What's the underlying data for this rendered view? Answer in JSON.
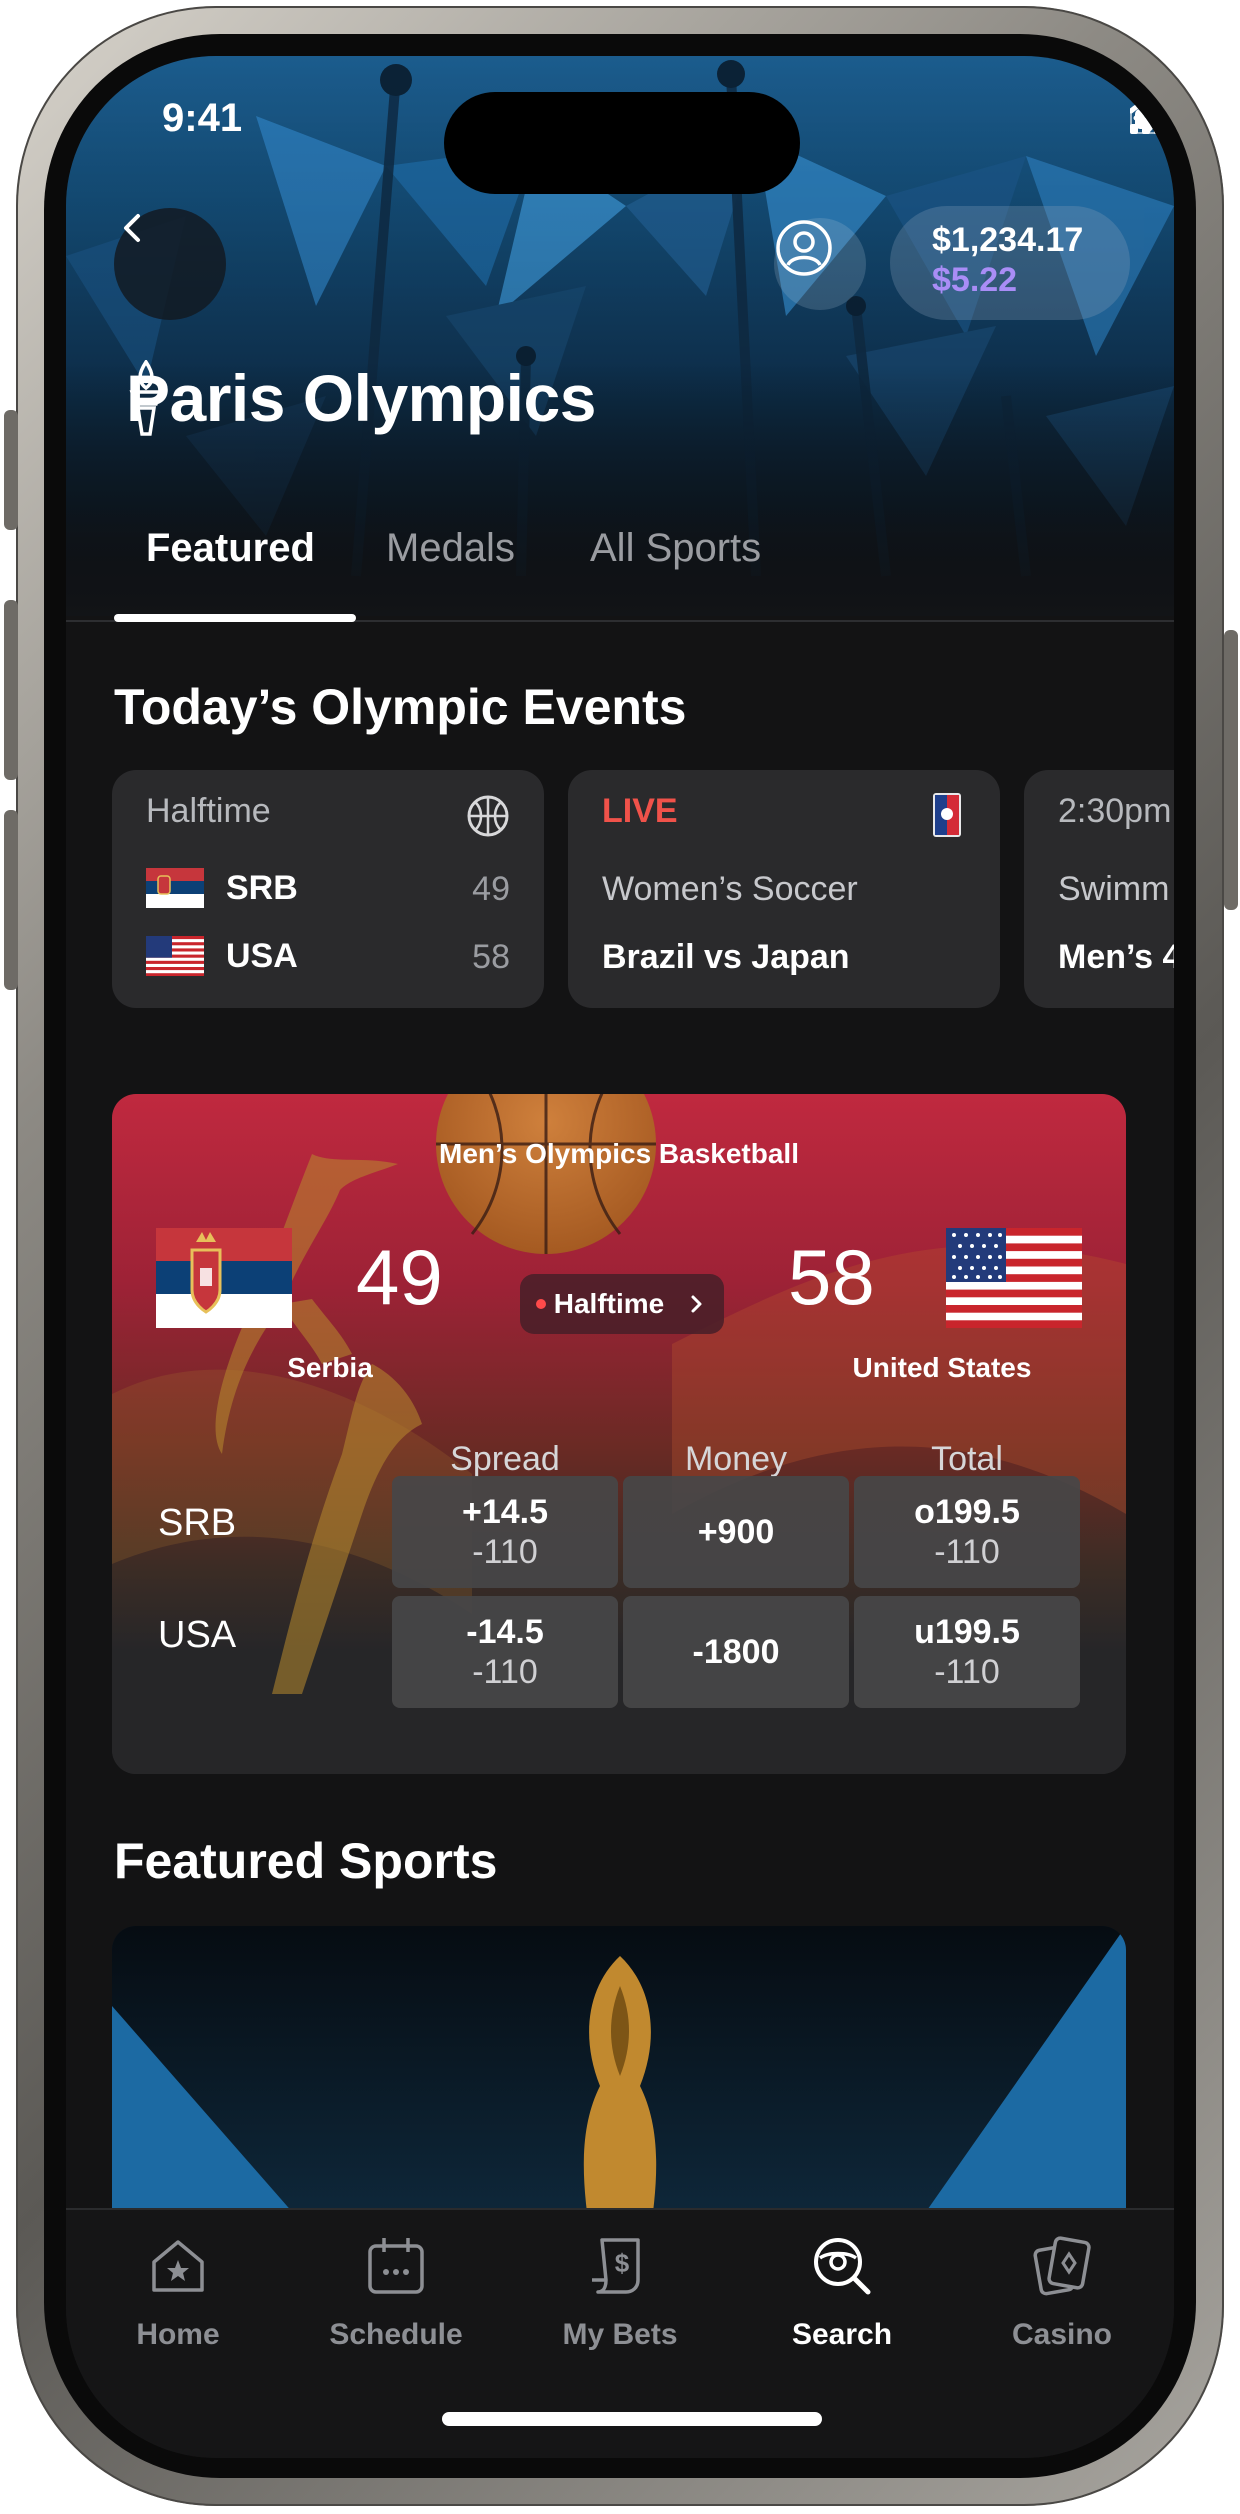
{
  "status_bar": {
    "time": "9:41"
  },
  "header": {
    "balance": "$1,234.17",
    "bonus_balance": "$5.22",
    "title": "Paris Olympics"
  },
  "tabs": [
    {
      "label": "Featured",
      "active": true
    },
    {
      "label": "Medals",
      "active": false
    },
    {
      "label": "All Sports",
      "active": false
    }
  ],
  "todays_events": {
    "title": "Today’s Olympic Events",
    "cards": [
      {
        "status": "Halftime",
        "icon": "basketball-icon",
        "teams": [
          {
            "code": "SRB",
            "score": "49"
          },
          {
            "code": "USA",
            "score": "58"
          }
        ]
      },
      {
        "status": "LIVE",
        "icon": "league-logo-icon",
        "sport": "Women’s Soccer",
        "matchup": "Brazil vs Japan"
      },
      {
        "status": "2:30pm",
        "sport": "Swimm",
        "matchup": "Men’s 4"
      }
    ]
  },
  "game": {
    "league": "Men’s Olympics Basketball",
    "home": {
      "name": "Serbia",
      "score": "49",
      "code": "SRB"
    },
    "away": {
      "name": "United States",
      "score": "58",
      "code": "USA"
    },
    "status": "Halftime",
    "columns": [
      "Spread",
      "Money",
      "Total"
    ],
    "rows": [
      {
        "team": "SRB",
        "spread": "+14.5",
        "spread_odds": "-110",
        "money": "+900",
        "total": "o199.5",
        "total_odds": "-110"
      },
      {
        "team": "USA",
        "spread": "-14.5",
        "spread_odds": "-110",
        "money": "-1800",
        "total": "u199.5",
        "total_odds": "-110"
      }
    ]
  },
  "featured_sports": {
    "title": "Featured Sports"
  },
  "tab_bar": [
    {
      "label": "Home",
      "icon": "home-icon",
      "active": false
    },
    {
      "label": "Schedule",
      "icon": "calendar-icon",
      "active": false
    },
    {
      "label": "My Bets",
      "icon": "bet-slip-icon",
      "active": false
    },
    {
      "label": "Search",
      "icon": "search-icon",
      "active": true
    },
    {
      "label": "Casino",
      "icon": "cards-icon",
      "active": false
    }
  ],
  "colors": {
    "accent_purple": "#a98df6",
    "live_red": "#f0524a",
    "background": "#131314",
    "card": "#2a2a2c"
  }
}
